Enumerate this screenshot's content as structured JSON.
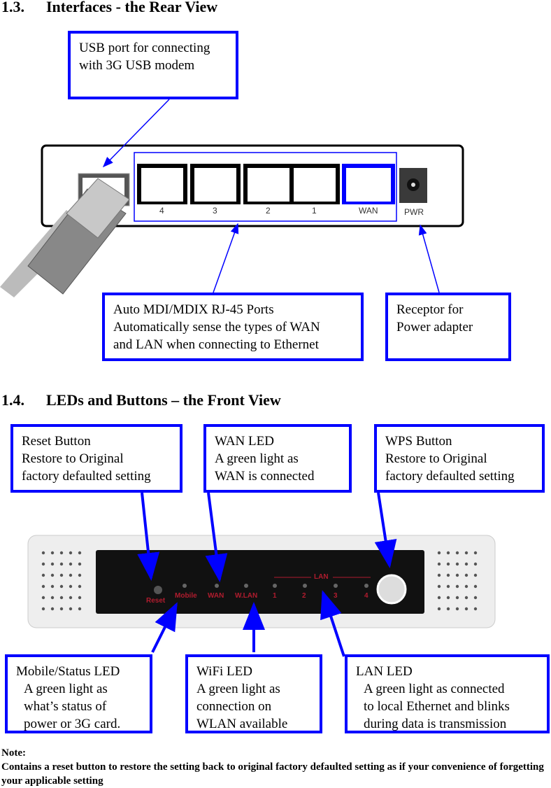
{
  "sections": [
    {
      "number": "1.3.",
      "title": "Interfaces - the Rear View"
    },
    {
      "number": "1.4.",
      "title": "LEDs and Buttons – the Front View"
    }
  ],
  "rear": {
    "usb_callout": [
      "USB port for connecting",
      "with 3G USB modem"
    ],
    "ports_callout": [
      "Auto MDI/MDIX RJ-45 Ports",
      "Automatically sense the types of WAN",
      "and LAN when connecting to Ethernet"
    ],
    "power_callout": [
      "Receptor for",
      "Power adapter"
    ],
    "port_labels": [
      "4",
      "3",
      "2",
      "1",
      "WAN"
    ],
    "power_label": "PWR"
  },
  "front": {
    "reset_callout": [
      "Reset Button",
      "Restore to Original",
      "factory defaulted setting"
    ],
    "wan_callout": [
      "WAN LED",
      "A green light as",
      "WAN is connected"
    ],
    "wps_callout": [
      "WPS Button",
      "Restore to Original",
      "factory defaulted setting"
    ],
    "mobile_callout": [
      "Mobile/Status LED",
      "A green light as",
      "what’s status of",
      "power or 3G card."
    ],
    "wifi_callout": [
      "WiFi LED",
      "A green light as",
      "connection on",
      "WLAN available"
    ],
    "lan_callout": [
      "LAN LED",
      "A green light as connected",
      "to local Ethernet and blinks",
      "during data is transmission"
    ],
    "panel_labels": {
      "reset": "Reset",
      "mobile": "Mobile",
      "wan": "WAN",
      "wlan": "W.LAN",
      "lan": "LAN",
      "lan_ports": [
        "1",
        "2",
        "3",
        "4"
      ]
    }
  },
  "note": {
    "title": "Note:",
    "text": "Contains a reset button to restore the setting back to original factory defaulted setting as if your convenience of forgetting your applicable setting"
  },
  "colors": {
    "callout": "#0000ff",
    "panel_text": "#b01c2e"
  }
}
